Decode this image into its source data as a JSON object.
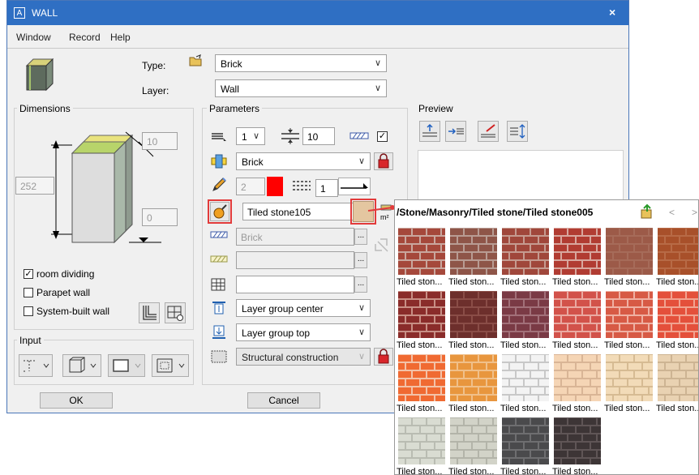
{
  "window": {
    "app_icon": "A",
    "title": "WALL",
    "close": "×"
  },
  "menu": [
    "Window",
    "Record",
    "Help"
  ],
  "type_label": "Type:",
  "type_value": "Brick",
  "layer_label": "Layer:",
  "layer_value": "Wall",
  "dimensions": {
    "title": "Dimensions",
    "thickness": "10",
    "height": "252",
    "offset": "0",
    "room_dividing_label": "room dividing",
    "room_dividing_checked": true,
    "parapet_label": "Parapet wall",
    "parapet_checked": false,
    "system_built_label": "System-built wall",
    "system_built_checked": false
  },
  "input_title": "Input",
  "parameters": {
    "title": "Parameters",
    "pen_value": "1",
    "layer_thickness": "10",
    "material": "Brick",
    "pen_thickness": "2",
    "line_style": "1",
    "surface": "Tiled stone105",
    "hatch_value": "Brick",
    "layer_group_center": "Layer group center",
    "layer_group_top": "Layer group top",
    "structural": "Structural construction",
    "ellipsis": "..."
  },
  "preview_title": "Preview",
  "ok_label": "OK",
  "cancel_label": "Cancel",
  "popup": {
    "path": "/Stone/Masonry/Tiled stone/Tiled stone005",
    "nav_back": "<",
    "nav_forward": ">",
    "tiles": [
      {
        "caption": "Tiled ston...",
        "color": "#a5483b",
        "mortar": "#c9a79e"
      },
      {
        "caption": "Tiled ston...",
        "color": "#8e5548",
        "mortar": "#b89c93"
      },
      {
        "caption": "Tiled ston...",
        "color": "#a0473b",
        "mortar": "#c59b90"
      },
      {
        "caption": "Tiled ston...",
        "color": "#b13c32",
        "mortar": "#d8a79e"
      },
      {
        "caption": "Tiled ston...",
        "color": "#9c5a48",
        "mortar": "#a66b59"
      },
      {
        "caption": "Tiled ston...",
        "color": "#a8502a",
        "mortar": "#b76a46"
      },
      {
        "caption": "Tiled ston...",
        "color": "#8a2c2a",
        "mortar": "#c88f85"
      },
      {
        "caption": "Tiled ston...",
        "color": "#6d2f2c",
        "mortar": "#8a4d47"
      },
      {
        "caption": "Tiled ston...",
        "color": "#7a3a45",
        "mortar": "#a27079"
      },
      {
        "caption": "Tiled ston...",
        "color": "#d2524a",
        "mortar": "#eaa9a1"
      },
      {
        "caption": "Tiled ston...",
        "color": "#d75a45",
        "mortar": "#efb0a2"
      },
      {
        "caption": "Tiled ston...",
        "color": "#e4503b",
        "mortar": "#f1a390"
      },
      {
        "caption": "Tiled ston...",
        "color": "#f06a32",
        "mortar": "#f3c2a8"
      },
      {
        "caption": "Tiled ston...",
        "color": "#e8963e",
        "mortar": "#f0c08a"
      },
      {
        "caption": "Tiled ston...",
        "color": "#f3f3f3",
        "mortar": "#c8c8c8"
      },
      {
        "caption": "Tiled ston...",
        "color": "#f5d5b5",
        "mortar": "#d9b596"
      },
      {
        "caption": "Tiled ston...",
        "color": "#f2dbb8",
        "mortar": "#d6bb93"
      },
      {
        "caption": "Tiled ston...",
        "color": "#e9d2b2",
        "mortar": "#cdb493"
      },
      {
        "caption": "Tiled ston...",
        "color": "#d9dcd2",
        "mortar": "#b9bcb2"
      },
      {
        "caption": "Tiled ston...",
        "color": "#d2d3c8",
        "mortar": "#b3b4a9"
      },
      {
        "caption": "Tiled ston...",
        "color": "#4a4a4c",
        "mortar": "#6e6e70"
      },
      {
        "caption": "Tiled ston...",
        "color": "#3d3536",
        "mortar": "#5f5556"
      }
    ]
  },
  "colors": {
    "accent": "#2f6fc3",
    "highlight": "#e23b3b",
    "pen_color": "#ff0000"
  }
}
